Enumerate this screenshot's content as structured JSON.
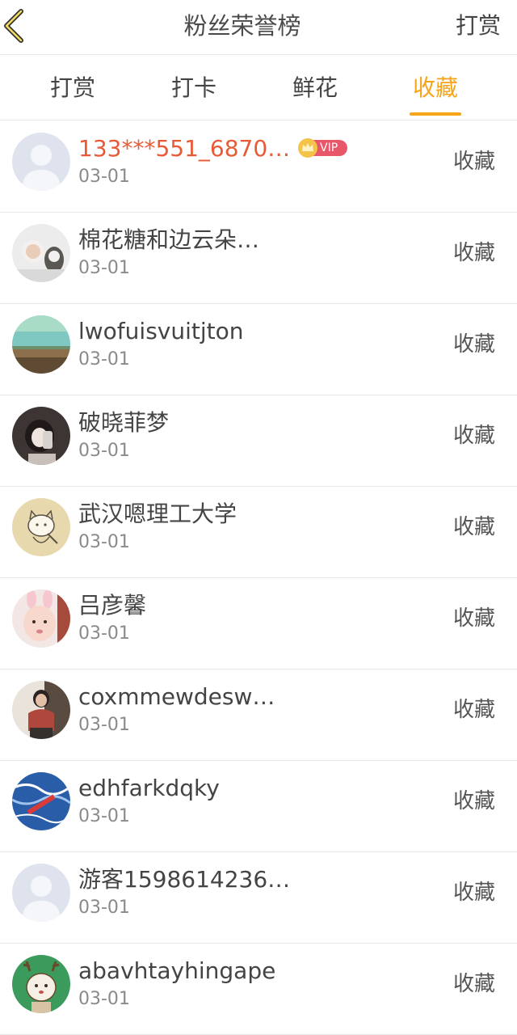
{
  "header": {
    "title": "粉丝荣誉榜",
    "action": "打赏"
  },
  "tabs": [
    {
      "label": "打赏"
    },
    {
      "label": "打卡"
    },
    {
      "label": "鲜花"
    },
    {
      "label": "收藏",
      "active": true
    }
  ],
  "list": [
    {
      "name": "133***551_6870…",
      "date": "03-01",
      "action": "收藏",
      "vip": true,
      "vip_label": "VIP"
    },
    {
      "name": "棉花糖和边云朵…",
      "date": "03-01",
      "action": "收藏"
    },
    {
      "name": "lwofuisvuitjton",
      "date": "03-01",
      "action": "收藏"
    },
    {
      "name": "破晓菲梦",
      "date": "03-01",
      "action": "收藏"
    },
    {
      "name": "武汉嗯理工大学",
      "date": "03-01",
      "action": "收藏"
    },
    {
      "name": "吕彦馨",
      "date": "03-01",
      "action": "收藏"
    },
    {
      "name": "coxmmewdesw…",
      "date": "03-01",
      "action": "收藏"
    },
    {
      "name": "edhfarkdqky",
      "date": "03-01",
      "action": "收藏"
    },
    {
      "name": "游客1598614236…",
      "date": "03-01",
      "action": "收藏"
    },
    {
      "name": "abavhtayhingape",
      "date": "03-01",
      "action": "收藏"
    }
  ],
  "colors": {
    "accent": "#f7a41a",
    "vip_name": "#e85a35",
    "vip_badge": "#e8566a"
  }
}
